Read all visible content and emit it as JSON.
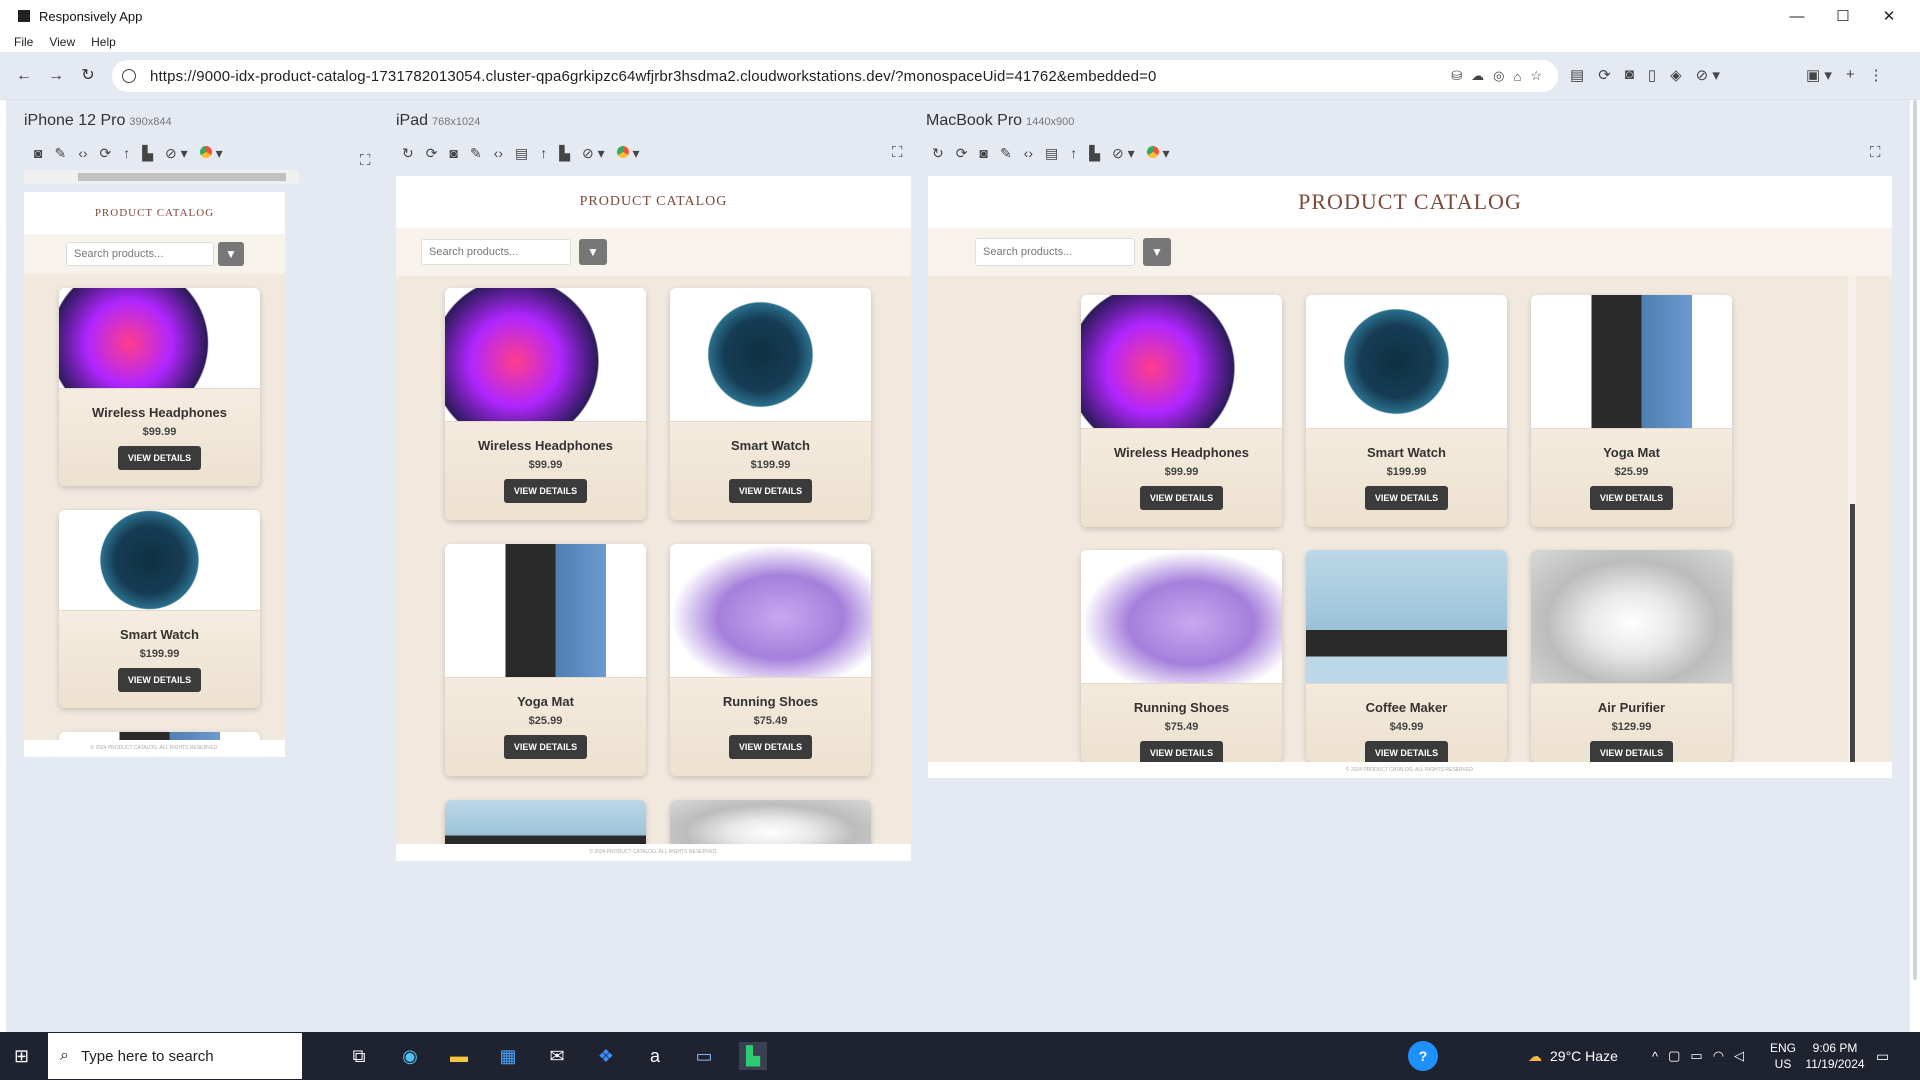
{
  "window": {
    "title": "Responsively App",
    "controls": [
      "—",
      "☐",
      "✕"
    ]
  },
  "menu": [
    "File",
    "View",
    "Help"
  ],
  "address": {
    "url": "https://9000-idx-product-catalog-1731782013054.cluster-qpa6grkipzc64wfjrbr3hsdma2.cloudworkstations.dev/?monospaceUid=41762&embedded=0"
  },
  "devices": [
    {
      "name": "iPhone 12 Pro",
      "size": "390x844"
    },
    {
      "name": "iPad",
      "size": "768x1024"
    },
    {
      "name": "MacBook Pro",
      "size": "1440x900"
    }
  ],
  "site": {
    "title": "PRODUCT CATALOG",
    "search_placeholder": "Search products...",
    "view_details": "VIEW DETAILS",
    "footer": "© 2024 PRODUCT CATALOG. ALL RIGHTS RESERVED."
  },
  "products": [
    {
      "name": "Wireless Headphones",
      "price": "$99.99"
    },
    {
      "name": "Smart Watch",
      "price": "$199.99"
    },
    {
      "name": "Yoga Mat",
      "price": "$25.99"
    },
    {
      "name": "Running Shoes",
      "price": "$75.49"
    },
    {
      "name": "Coffee Maker",
      "price": "$49.99"
    },
    {
      "name": "Air Purifier",
      "price": "$129.99"
    }
  ],
  "taskbar": {
    "search_placeholder": "Type here to search",
    "weather": "29°C Haze",
    "lang": "ENG",
    "region": "US",
    "time": "9:06 PM",
    "date": "11/19/2024"
  }
}
